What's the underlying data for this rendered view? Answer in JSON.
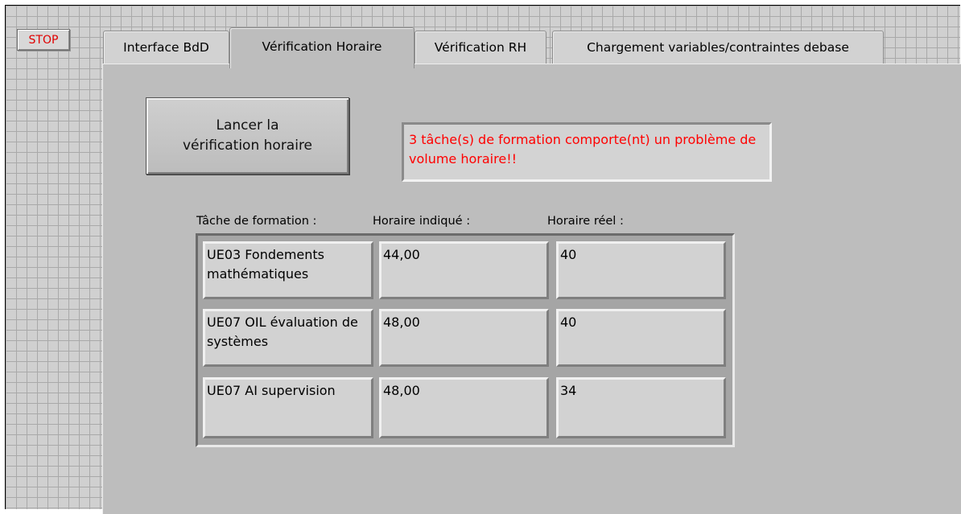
{
  "stop_button": {
    "label": "STOP"
  },
  "tabs": [
    {
      "label": "Interface BdD",
      "active": false
    },
    {
      "label": "Vérification Horaire",
      "active": true
    },
    {
      "label": "Vérification RH",
      "active": false
    },
    {
      "label": "Chargement variables/contraintes debase",
      "active": false
    }
  ],
  "launch_button": {
    "label": "Lancer la\nvérification horaire"
  },
  "status_message": "3 tâche(s) de formation comporte(nt) un problème de volume horaire!!",
  "table": {
    "headers": [
      "Tâche de formation :",
      "Horaire indiqué :",
      "Horaire réel :"
    ],
    "rows": [
      {
        "task": "UE03 Fondements mathématiques",
        "indicated": "44,00",
        "real": "40"
      },
      {
        "task": "UE07 OIL évaluation de systèmes",
        "indicated": "48,00",
        "real": "40"
      },
      {
        "task": "UE07 AI supervision",
        "indicated": "48,00",
        "real": "34"
      }
    ]
  },
  "colors": {
    "panel_bg": "#bdbdbd",
    "grid_bg": "#d0d0d0",
    "stop_text": "#e00000",
    "status_text": "#ff0000"
  }
}
